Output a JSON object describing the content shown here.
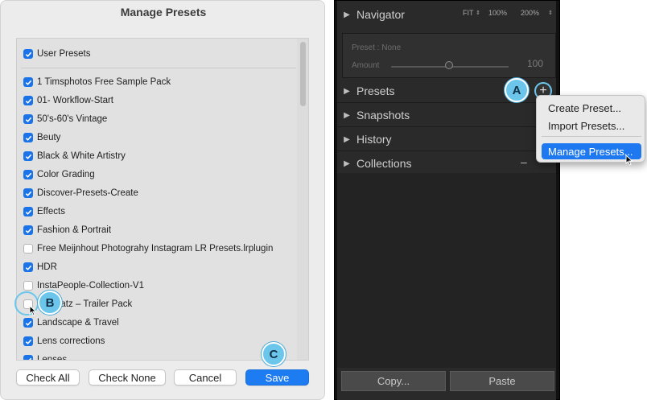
{
  "dialog": {
    "title": "Manage Presets",
    "top_item": {
      "label": "User Presets",
      "checked": true
    },
    "items": [
      {
        "label": "1 Timsphotos Free Sample Pack",
        "checked": true
      },
      {
        "label": "01- Workflow-Start",
        "checked": true
      },
      {
        "label": "50's-60's Vintage",
        "checked": true
      },
      {
        "label": "Beuty",
        "checked": true
      },
      {
        "label": "Black & White Artistry",
        "checked": true
      },
      {
        "label": "Color Grading",
        "checked": true
      },
      {
        "label": "Discover-Presets-Create",
        "checked": true
      },
      {
        "label": "Effects",
        "checked": true
      },
      {
        "label": "Fashion & Portrait",
        "checked": true
      },
      {
        "label": "Free Meijnhout Photograhy Instagram LR Presets.lrplugin",
        "checked": false
      },
      {
        "label": "HDR",
        "checked": true
      },
      {
        "label": "InstaPeople-Collection-V1",
        "checked": false
      },
      {
        "label": "Joe Batz – Trailer Pack",
        "checked": false
      },
      {
        "label": "Landscape & Travel",
        "checked": true
      },
      {
        "label": "Lens corrections",
        "checked": true
      },
      {
        "label": "Lenses",
        "checked": true
      }
    ],
    "buttons": {
      "check_all": "Check All",
      "check_none": "Check None",
      "cancel": "Cancel",
      "save": "Save"
    }
  },
  "callouts": {
    "a": "A",
    "b": "B",
    "c": "C"
  },
  "lightroom": {
    "navigator": {
      "title": "Navigator",
      "fit": "FIT",
      "zoom1": "100%",
      "zoom2": "200%"
    },
    "preset_box": {
      "preset_label": "Preset : None",
      "amount_label": "Amount",
      "amount_value": "100"
    },
    "panels": [
      "Presets",
      "Snapshots",
      "History",
      "Collections"
    ],
    "collections_minus": "–",
    "plus_symbol": "+",
    "buttons": {
      "copy": "Copy...",
      "paste": "Paste"
    }
  },
  "menu": {
    "items": [
      "Create Preset...",
      "Import Presets...",
      "Manage Presets..."
    ],
    "highlighted": "Manage Presets..."
  },
  "colors": {
    "accent": "#1d7cf2",
    "callout": "#6cc6ec",
    "lr_bg": "#2a2a2a"
  }
}
